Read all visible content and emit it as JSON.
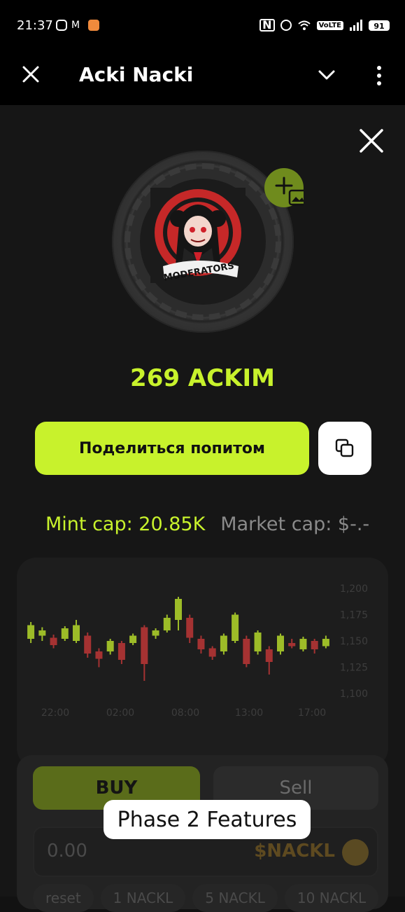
{
  "status_bar": {
    "time": "21:37",
    "battery": "91",
    "volte": "VoLTE"
  },
  "app_bar": {
    "title": "Acki Nacki"
  },
  "avatar": {
    "caption": "MODERATORS"
  },
  "token": {
    "amount": "269 ACKIM"
  },
  "actions": {
    "share_label": "Поделиться попитом"
  },
  "caps": {
    "mint": "Mint cap: 20.85K",
    "market": "Market cap: $-.-"
  },
  "chart_data": {
    "type": "candlestick",
    "x_ticks": [
      "22:00",
      "02:00",
      "08:00",
      "13:00",
      "17:00"
    ],
    "y_ticks": [
      "1,200",
      "1,175",
      "1,150",
      "1,125",
      "1,100"
    ],
    "ylim": [
      1100,
      1200
    ],
    "candles": [
      {
        "o": 1152,
        "c": 1165,
        "h": 1168,
        "l": 1148
      },
      {
        "o": 1155,
        "c": 1160,
        "h": 1163,
        "l": 1150
      },
      {
        "o": 1153,
        "c": 1146,
        "h": 1156,
        "l": 1143
      },
      {
        "o": 1152,
        "c": 1162,
        "h": 1164,
        "l": 1150
      },
      {
        "o": 1150,
        "c": 1165,
        "h": 1170,
        "l": 1148
      },
      {
        "o": 1155,
        "c": 1138,
        "h": 1158,
        "l": 1134
      },
      {
        "o": 1140,
        "c": 1133,
        "h": 1143,
        "l": 1125
      },
      {
        "o": 1140,
        "c": 1150,
        "h": 1152,
        "l": 1137
      },
      {
        "o": 1148,
        "c": 1132,
        "h": 1150,
        "l": 1128
      },
      {
        "o": 1148,
        "c": 1155,
        "h": 1157,
        "l": 1146
      },
      {
        "o": 1163,
        "c": 1128,
        "h": 1165,
        "l": 1112
      },
      {
        "o": 1155,
        "c": 1160,
        "h": 1162,
        "l": 1152
      },
      {
        "o": 1160,
        "c": 1172,
        "h": 1175,
        "l": 1158
      },
      {
        "o": 1170,
        "c": 1190,
        "h": 1192,
        "l": 1160
      },
      {
        "o": 1172,
        "c": 1153,
        "h": 1175,
        "l": 1148
      },
      {
        "o": 1152,
        "c": 1142,
        "h": 1155,
        "l": 1138
      },
      {
        "o": 1143,
        "c": 1135,
        "h": 1145,
        "l": 1132
      },
      {
        "o": 1140,
        "c": 1155,
        "h": 1157,
        "l": 1137
      },
      {
        "o": 1150,
        "c": 1175,
        "h": 1177,
        "l": 1148
      },
      {
        "o": 1152,
        "c": 1128,
        "h": 1155,
        "l": 1125
      },
      {
        "o": 1140,
        "c": 1158,
        "h": 1160,
        "l": 1137
      },
      {
        "o": 1142,
        "c": 1130,
        "h": 1145,
        "l": 1118
      },
      {
        "o": 1140,
        "c": 1155,
        "h": 1157,
        "l": 1137
      },
      {
        "o": 1148,
        "c": 1145,
        "h": 1152,
        "l": 1143
      },
      {
        "o": 1142,
        "c": 1152,
        "h": 1154,
        "l": 1140
      },
      {
        "o": 1150,
        "c": 1142,
        "h": 1152,
        "l": 1138
      },
      {
        "o": 1145,
        "c": 1152,
        "h": 1155,
        "l": 1143
      }
    ],
    "up_color": "#c8f22c",
    "down_color": "#d33a3a"
  },
  "trade": {
    "buy_label": "BUY",
    "sell_label": "Sell",
    "amount_value": "0.00",
    "currency": "$NACKL",
    "chips": [
      "reset",
      "1 NACKL",
      "5 NACKL",
      "10 NACKL"
    ]
  },
  "tooltip": {
    "text": "Phase 2 Features"
  }
}
